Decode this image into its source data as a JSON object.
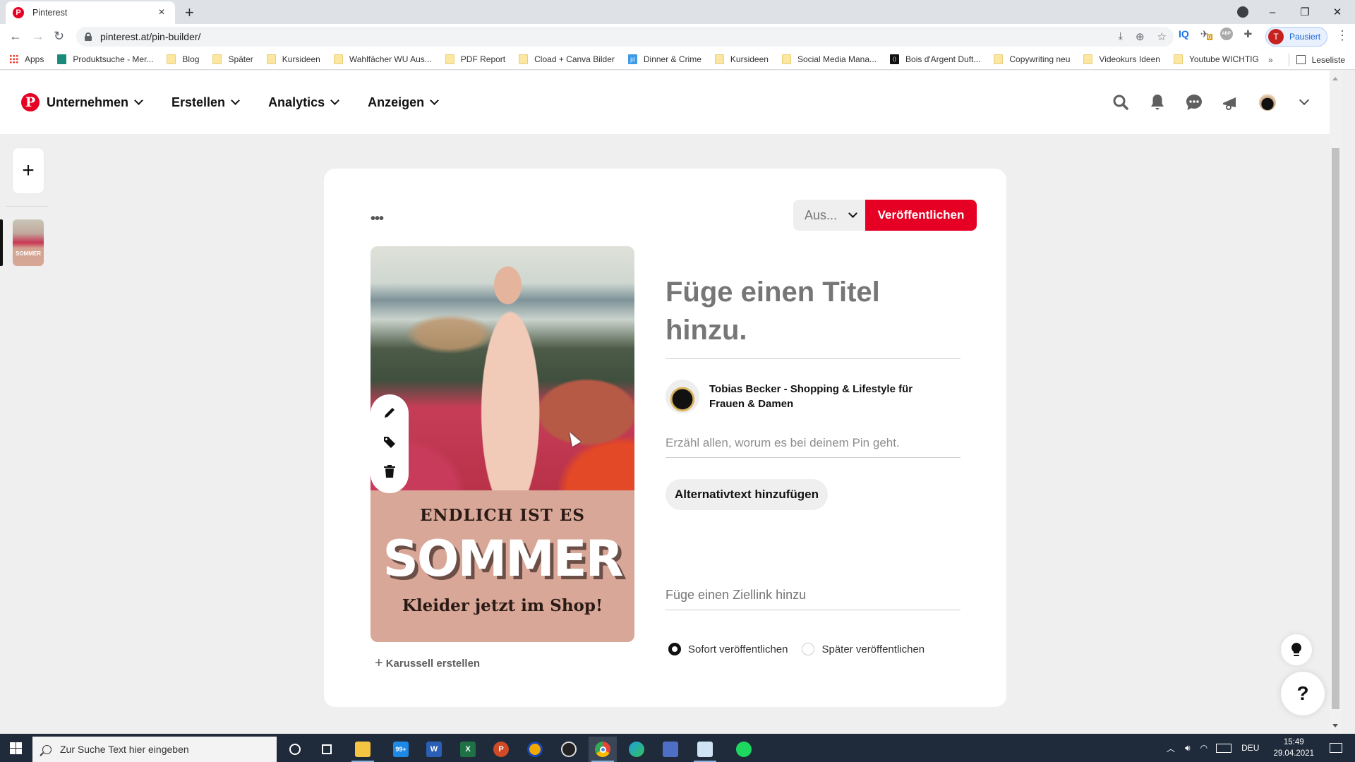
{
  "browser": {
    "tab_title": "Pinterest",
    "tab_close": "×",
    "new_tab": "+",
    "url": "pinterest.at/pin-builder/",
    "window_controls": {
      "minimize": "–",
      "restore": "❐",
      "close": "✕"
    },
    "profile_initial": "T",
    "profile_status": "Pausiert",
    "extension_iq": "IQ",
    "extension_badge": "0",
    "extension_abp": "ABP",
    "bookmarks": [
      {
        "label": "Apps",
        "icon": "apps"
      },
      {
        "label": "Produktsuche - Mer...",
        "icon": "shirt"
      },
      {
        "label": "Blog",
        "icon": "folder"
      },
      {
        "label": "Später",
        "icon": "folder"
      },
      {
        "label": "Kursideen",
        "icon": "folder"
      },
      {
        "label": "Wahlfächer WU Aus...",
        "icon": "folder"
      },
      {
        "label": "PDF Report",
        "icon": "folder"
      },
      {
        "label": "Cload + Canva Bilder",
        "icon": "folder"
      },
      {
        "label": "Dinner & Crime",
        "icon": "jd"
      },
      {
        "label": "Kursideen",
        "icon": "folder"
      },
      {
        "label": "Social Media Mana...",
        "icon": "folder"
      },
      {
        "label": "Bois d'Argent Duft...",
        "icon": "ba"
      },
      {
        "label": "Copywriting neu",
        "icon": "folder"
      },
      {
        "label": "Videokurs Ideen",
        "icon": "folder"
      },
      {
        "label": "Youtube WICHTIG",
        "icon": "folder"
      }
    ],
    "bookmarks_overflow": "»",
    "reading_list": "Leseliste"
  },
  "header": {
    "logo_glyph": "P",
    "nav": [
      {
        "label": "Unternehmen"
      },
      {
        "label": "Erstellen"
      },
      {
        "label": "Analytics"
      },
      {
        "label": "Anzeigen"
      }
    ],
    "icons": [
      "search-icon",
      "bell-icon",
      "messages-icon",
      "megaphone-icon",
      "avatar",
      "chevron-down-icon"
    ]
  },
  "rail": {
    "add_label": "+",
    "draft_thumb_text": "SOMMER"
  },
  "pin_builder": {
    "more_options": "•••",
    "board_select": "Aus...",
    "publish_label": "Veröffentlichen",
    "image_text": {
      "line1": "ENDLICH IST ES",
      "line2": "SOMMER",
      "line3": "Kleider jetzt im Shop!"
    },
    "image_tools": [
      "edit-icon",
      "tag-icon",
      "trash-icon"
    ],
    "carousel_label": "Karussell erstellen",
    "title_placeholder": "Füge einen Titel hinzu.",
    "creator_name": "Tobias Becker - Shopping & Lifestyle für Frauen & Damen",
    "description_placeholder": "Erzähl allen, worum es bei deinem Pin geht.",
    "alt_text_button": "Alternativtext hinzufügen",
    "link_placeholder": "Füge einen Ziellink hinzu",
    "publish_options": [
      {
        "label": "Sofort veröffentlichen",
        "selected": true
      },
      {
        "label": "Später veröffentlichen",
        "selected": false
      }
    ]
  },
  "floating": {
    "help_label": "?"
  },
  "taskbar": {
    "search_placeholder": "Zur Suche Text hier eingeben",
    "mail_badge": "99+",
    "tray_language": "DEU",
    "time": "15:49",
    "date": "29.04.2021"
  }
}
